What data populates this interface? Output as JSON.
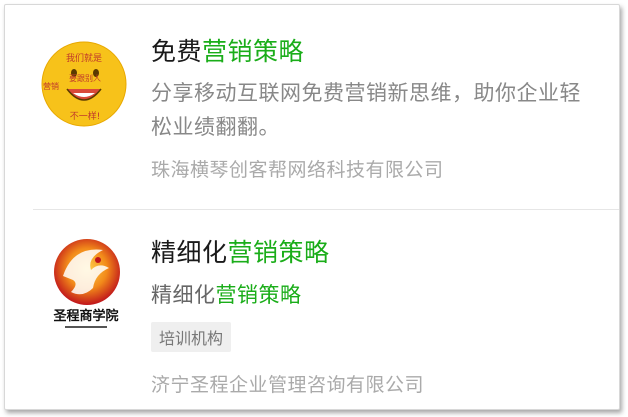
{
  "items": [
    {
      "title_plain": "免费",
      "title_highlight": "营销策略",
      "description": "分享移动互联网免费营销新思维，助你企业轻松业绩翻翻。",
      "company": "珠海横琴创客帮网络科技有限公司",
      "logo": {
        "icon": "smiley-face-logo-icon",
        "text_top": "我们就是",
        "text_mid": "要跟别人",
        "text_left": "营销",
        "text_bottom": "不一样!"
      }
    },
    {
      "title_plain": "精细化",
      "title_highlight": "营销策略",
      "description_plain": "精细化",
      "description_highlight": "营销策略",
      "tag": "培训机构",
      "company": "济宁圣程企业管理咨询有限公司",
      "logo": {
        "icon": "phoenix-logo-icon",
        "text": "圣程商学院"
      }
    }
  ],
  "colors": {
    "highlight": "#1aad19",
    "title": "#1a1a1a",
    "muted": "#aaaaaa"
  }
}
